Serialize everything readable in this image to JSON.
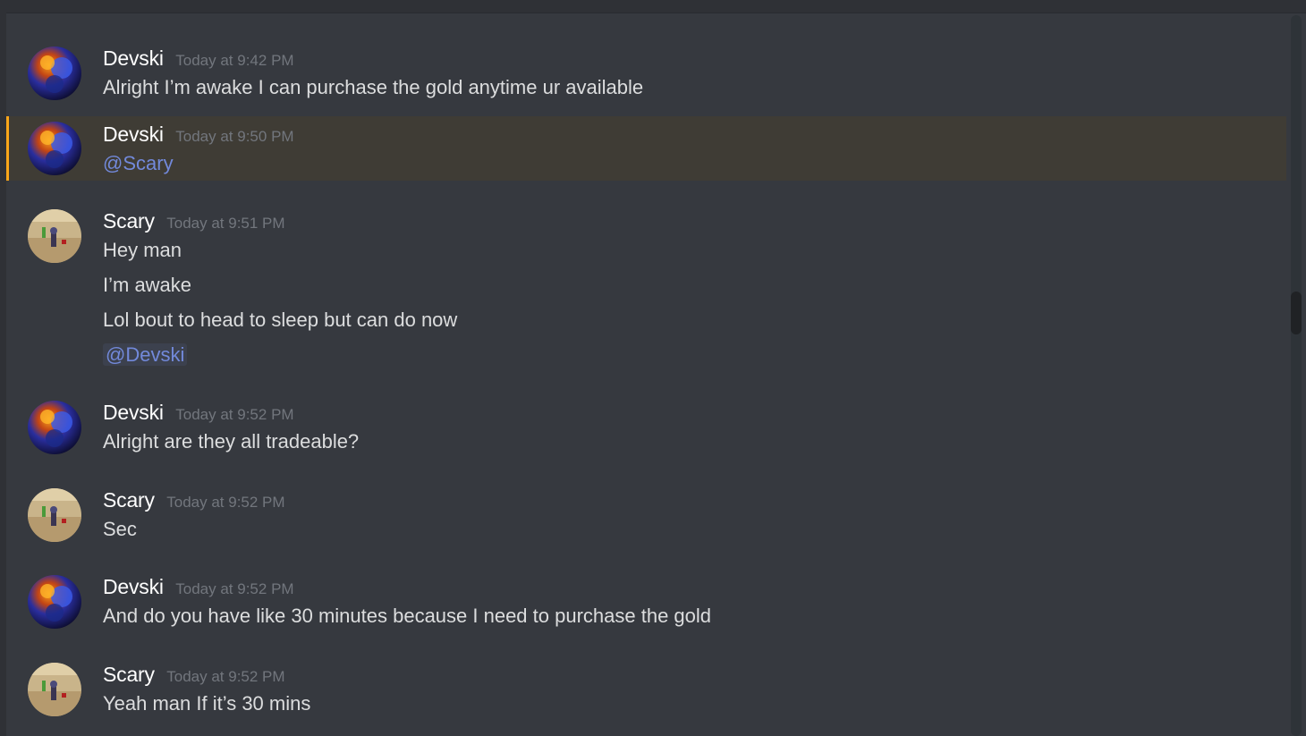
{
  "users": {
    "devski": {
      "name": "Devski"
    },
    "scary": {
      "name": "Scary"
    }
  },
  "messages": [
    {
      "author": "Devski",
      "timestamp": "Today at 9:42 PM",
      "lines": [
        "Alright I’m awake I can purchase the gold anytime ur available"
      ]
    },
    {
      "author": "Devski",
      "timestamp": "Today at 9:50 PM",
      "lines": [
        "@Scary"
      ],
      "mentioned": true
    },
    {
      "author": "Scary",
      "timestamp": "Today at 9:51 PM",
      "lines": [
        "Hey man",
        "I’m awake",
        "Lol bout to head to sleep but can do now",
        "@Devski"
      ]
    },
    {
      "author": "Devski",
      "timestamp": "Today at 9:52 PM",
      "lines": [
        "Alright are they all tradeable?"
      ]
    },
    {
      "author": "Scary",
      "timestamp": "Today at 9:52 PM",
      "lines": [
        "Sec"
      ]
    },
    {
      "author": "Devski",
      "timestamp": "Today at 9:52 PM",
      "lines": [
        "And do you have like 30 minutes because I need to purchase the gold"
      ]
    },
    {
      "author": "Scary",
      "timestamp": "Today at 9:52 PM",
      "lines": [
        "Yeah man If it’s 30 mins"
      ]
    }
  ],
  "colors": {
    "background": "#36393f",
    "mention": "#7289da",
    "highlight_bar": "#faa61a",
    "author": "#ffffff",
    "timestamp": "#72767d",
    "text": "#dcddde"
  }
}
